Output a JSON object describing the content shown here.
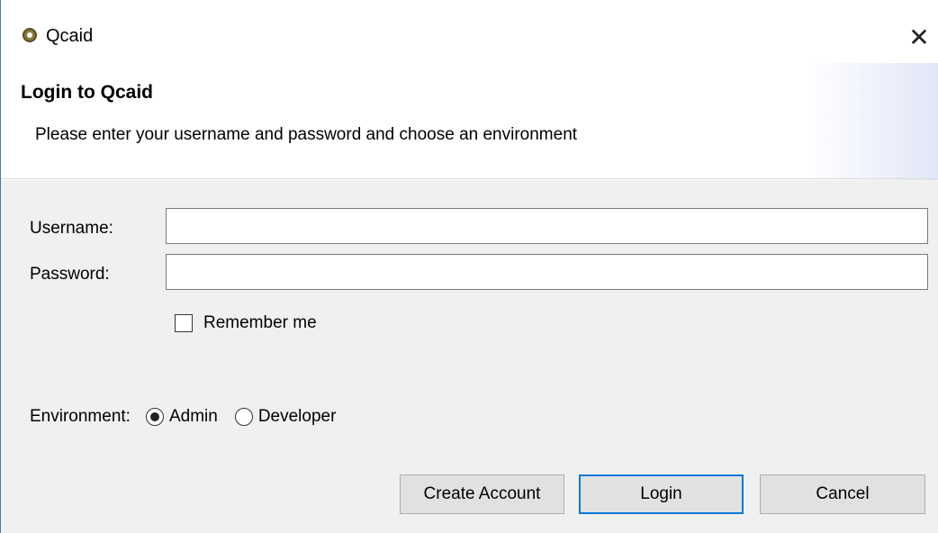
{
  "window": {
    "title": "Qcaid",
    "close_glyph": "✕",
    "app_icon": "qcaid-app-icon"
  },
  "banner": {
    "title": "Login to Qcaid",
    "subtitle": "Please enter your username and password and choose an environment"
  },
  "form": {
    "username_label": "Username:",
    "username_value": "",
    "password_label": "Password:",
    "password_value": "",
    "remember_label": "Remember me",
    "remember_checked": false,
    "environment_label": "Environment:",
    "environment_options": [
      {
        "label": "Admin",
        "selected": true
      },
      {
        "label": "Developer",
        "selected": false
      }
    ]
  },
  "buttons": {
    "create_account": "Create Account",
    "login": "Login",
    "cancel": "Cancel"
  },
  "colors": {
    "accent": "#0078d7",
    "window_border": "#3c7fb1",
    "dialog_bg": "#f0f0f0"
  }
}
